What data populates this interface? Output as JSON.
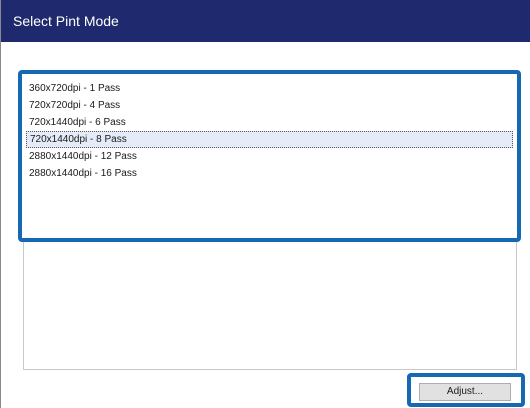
{
  "window": {
    "title": "Select Pint Mode"
  },
  "modes": [
    {
      "label": "360x720dpi - 1 Pass",
      "selected": false
    },
    {
      "label": "720x720dpi - 4 Pass",
      "selected": false
    },
    {
      "label": "720x1440dpi - 6 Pass",
      "selected": false
    },
    {
      "label": "720x1440dpi - 8 Pass",
      "selected": true
    },
    {
      "label": "2880x1440dpi - 12 Pass",
      "selected": false
    },
    {
      "label": "2880x1440dpi - 16 Pass",
      "selected": false
    }
  ],
  "actions": {
    "adjust_label": "Adjust..."
  },
  "colors": {
    "titlebar": "#1f2a6e",
    "highlight_frame": "#1668b3",
    "selection": "#e5ebf7"
  }
}
